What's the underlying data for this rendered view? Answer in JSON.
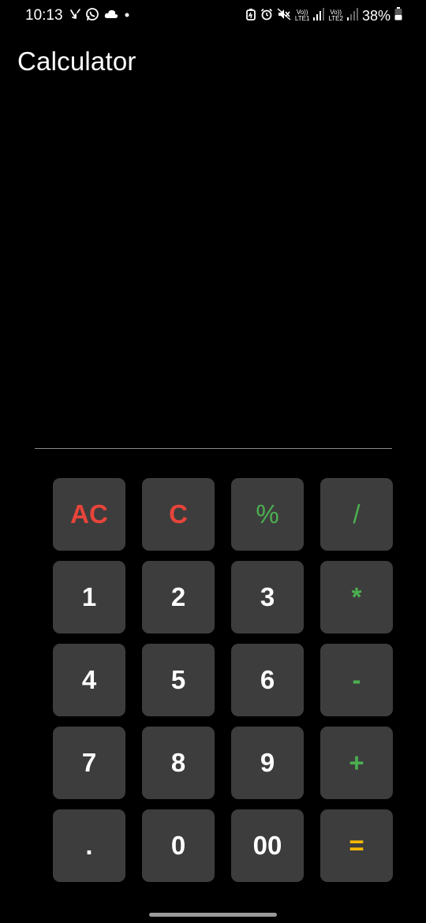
{
  "status_bar": {
    "time": "10:13",
    "left_icons": [
      "missed-call-icon",
      "whatsapp-icon",
      "cloud-icon",
      "dot-icon"
    ],
    "right_icons": [
      "battery-saver-icon",
      "alarm-icon",
      "mute-icon",
      "signal-lte1-icon",
      "signal-lte2-icon",
      "battery-icon"
    ],
    "sim1_label_top": "Vo))",
    "sim1_label_bottom": "LTE1",
    "sim2_label_top": "Vo))",
    "sim2_label_bottom": "LTE2",
    "battery_percent": "38%"
  },
  "app": {
    "title": "Calculator"
  },
  "display": {
    "value": ""
  },
  "keypad": {
    "rows": [
      [
        "AC",
        "C",
        "%",
        "/"
      ],
      [
        "1",
        "2",
        "3",
        "*"
      ],
      [
        "4",
        "5",
        "6",
        "-"
      ],
      [
        "7",
        "8",
        "9",
        "+"
      ],
      [
        ".",
        "0",
        "00",
        "="
      ]
    ]
  },
  "colors": {
    "background": "#000000",
    "key_background": "#3d3d3d",
    "clear_keys": "#e8443a",
    "operator_keys": "#4caf50",
    "equals_key": "#f5b800",
    "digit_keys": "#ffffff",
    "divider": "#8a8a8a"
  }
}
